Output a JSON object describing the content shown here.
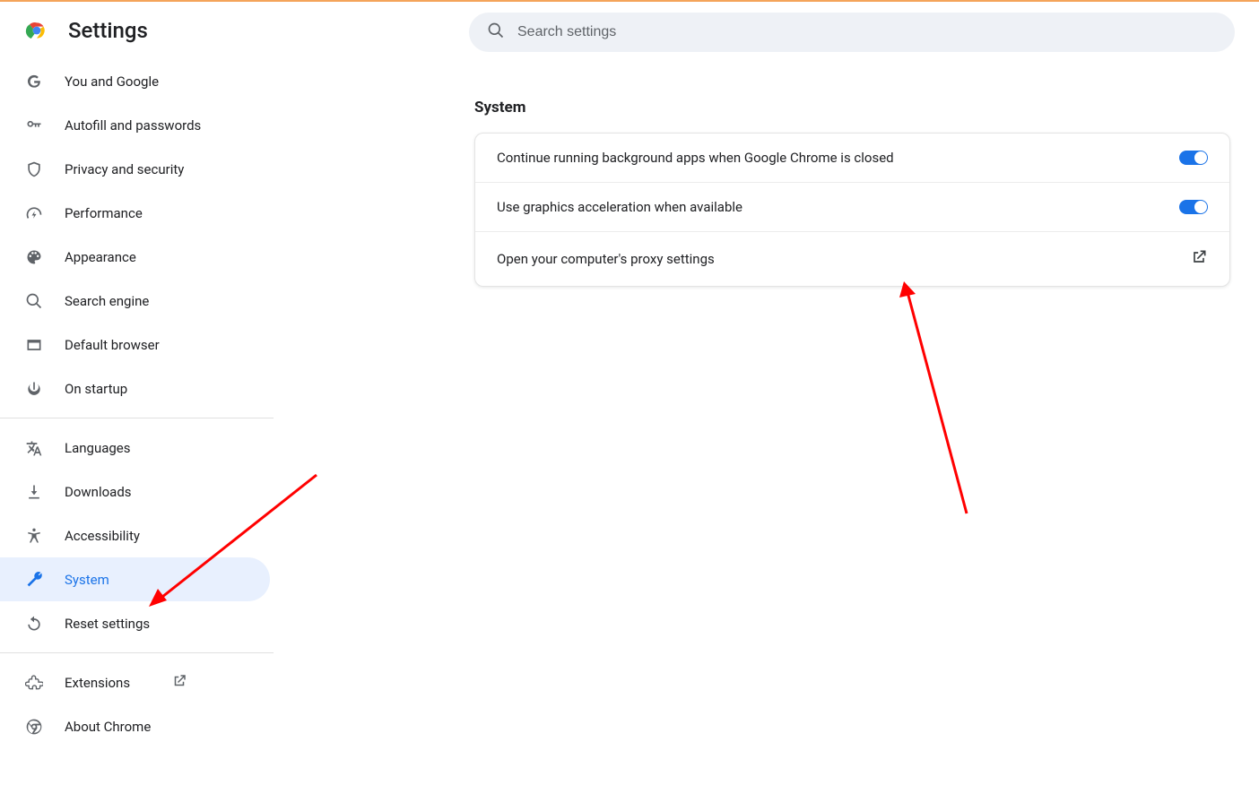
{
  "header": {
    "title": "Settings"
  },
  "search": {
    "placeholder": "Search settings"
  },
  "sidebar": {
    "groups": [
      [
        {
          "id": "you-google",
          "label": "You and Google"
        },
        {
          "id": "autofill",
          "label": "Autofill and passwords"
        },
        {
          "id": "privacy",
          "label": "Privacy and security"
        },
        {
          "id": "performance",
          "label": "Performance"
        },
        {
          "id": "appearance",
          "label": "Appearance"
        },
        {
          "id": "search-engine",
          "label": "Search engine"
        },
        {
          "id": "default-browser",
          "label": "Default browser"
        },
        {
          "id": "on-startup",
          "label": "On startup"
        }
      ],
      [
        {
          "id": "languages",
          "label": "Languages"
        },
        {
          "id": "downloads",
          "label": "Downloads"
        },
        {
          "id": "accessibility",
          "label": "Accessibility"
        },
        {
          "id": "system",
          "label": "System",
          "active": true
        },
        {
          "id": "reset",
          "label": "Reset settings"
        }
      ],
      [
        {
          "id": "extensions",
          "label": "Extensions",
          "external": true
        },
        {
          "id": "about",
          "label": "About Chrome"
        }
      ]
    ]
  },
  "main": {
    "section_title": "System",
    "rows": [
      {
        "label": "Continue running background apps when Google Chrome is closed",
        "toggle": true
      },
      {
        "label": "Use graphics acceleration when available",
        "toggle": true
      },
      {
        "label": "Open your computer's proxy settings",
        "link": true
      }
    ]
  }
}
